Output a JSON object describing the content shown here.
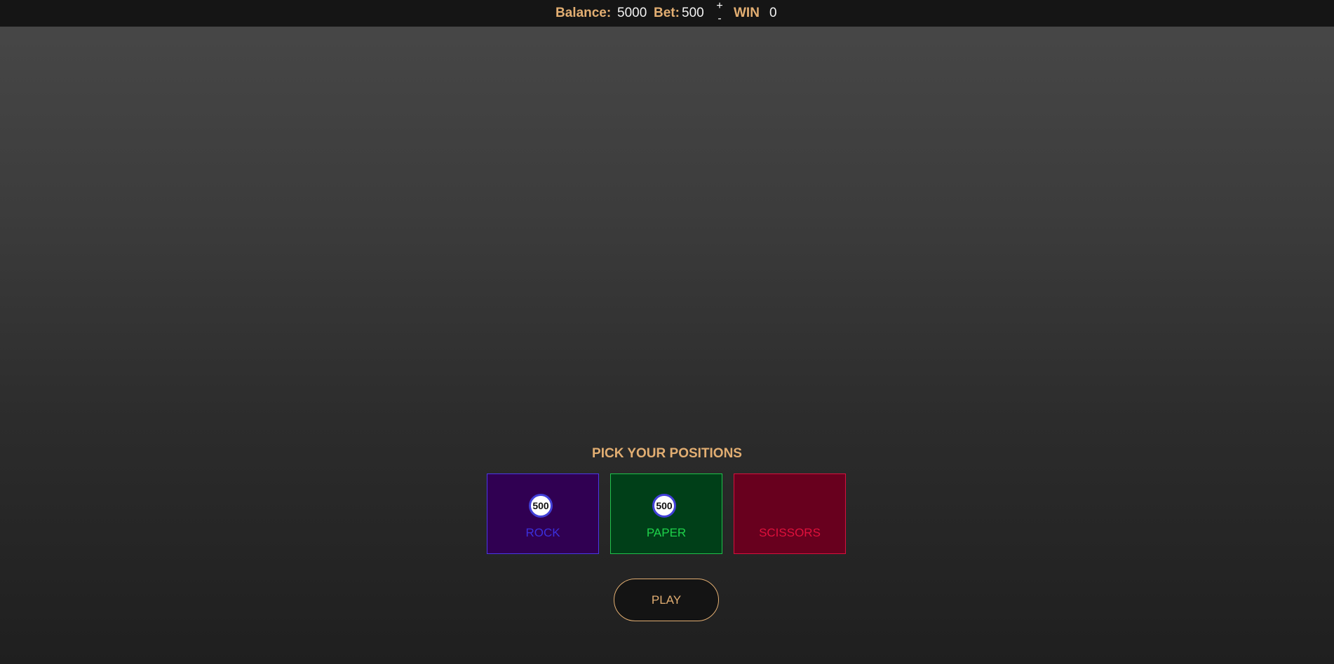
{
  "header": {
    "balance_label": "Balance:",
    "balance_value": "5000",
    "bet_label": "Bet:",
    "bet_value": "500",
    "bet_increase_label": "+",
    "bet_decrease_label": "-",
    "win_label": "WIN",
    "win_value": "0"
  },
  "game": {
    "pick_title": "PICK YOUR POSITIONS",
    "positions": [
      {
        "label": "ROCK",
        "chip": "500",
        "color": "#3c2fdc",
        "background": "#300052",
        "border": "#4a37e8"
      },
      {
        "label": "PAPER",
        "chip": "500",
        "color": "#1ed24a",
        "background": "#003f18",
        "border": "#1ec24a"
      },
      {
        "label": "SCISSORS",
        "chip": null,
        "color": "#e0103c",
        "background": "#68001e",
        "border": "#d8103c"
      }
    ],
    "play_label": "PLAY"
  },
  "colors": {
    "accent": "#e2ae72",
    "topbar": "#151515",
    "chip_ring": "#4240d8"
  }
}
